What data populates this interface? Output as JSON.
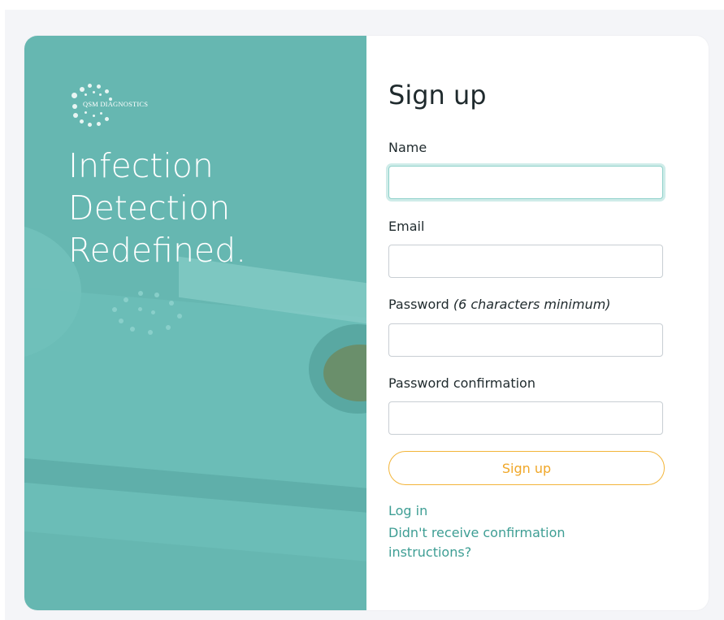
{
  "brand": {
    "logo_text": "QSM DIAGNOSTICS",
    "tagline_lines": [
      "Infection",
      "Detection",
      "Redefined."
    ],
    "hero_color": "#66b7b1"
  },
  "form": {
    "title": "Sign up",
    "fields": {
      "name": {
        "label": "Name",
        "value": ""
      },
      "email": {
        "label": "Email",
        "value": ""
      },
      "password": {
        "label": "Password",
        "hint": "(6 characters minimum)",
        "value": ""
      },
      "password_confirmation": {
        "label": "Password confirmation",
        "value": ""
      }
    },
    "submit_label": "Sign up",
    "accent_color": "#f3b53a"
  },
  "links": {
    "login": "Log in",
    "confirmation": "Didn't receive confirmation instructions?",
    "link_color": "#3e9e94"
  }
}
